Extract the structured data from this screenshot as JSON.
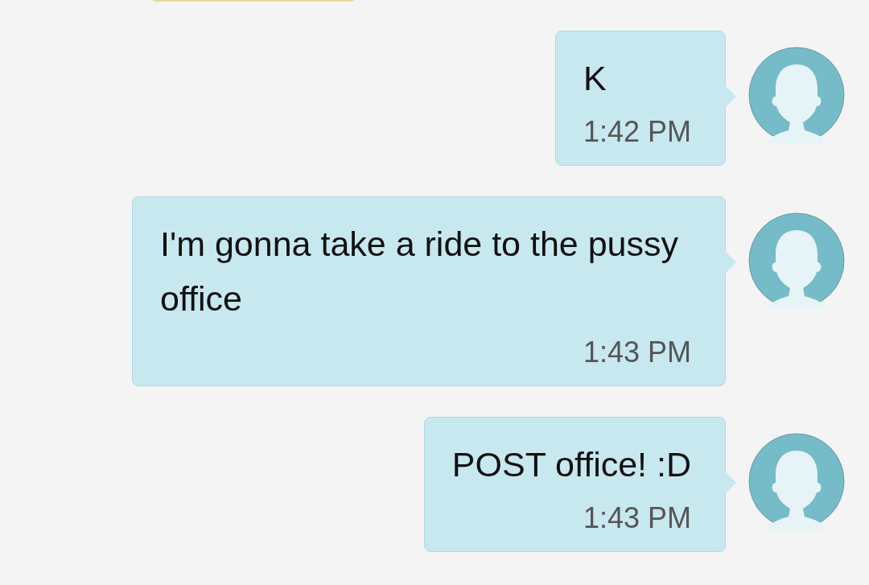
{
  "messages": [
    {
      "kind": "outgoing",
      "text": "K",
      "time": "1:42 PM"
    },
    {
      "kind": "outgoing",
      "text": "I'm gonna take a ride to the pussy office",
      "time": "1:43 PM"
    },
    {
      "kind": "outgoing",
      "text": "POST office! :D",
      "time": "1:43 PM"
    }
  ]
}
